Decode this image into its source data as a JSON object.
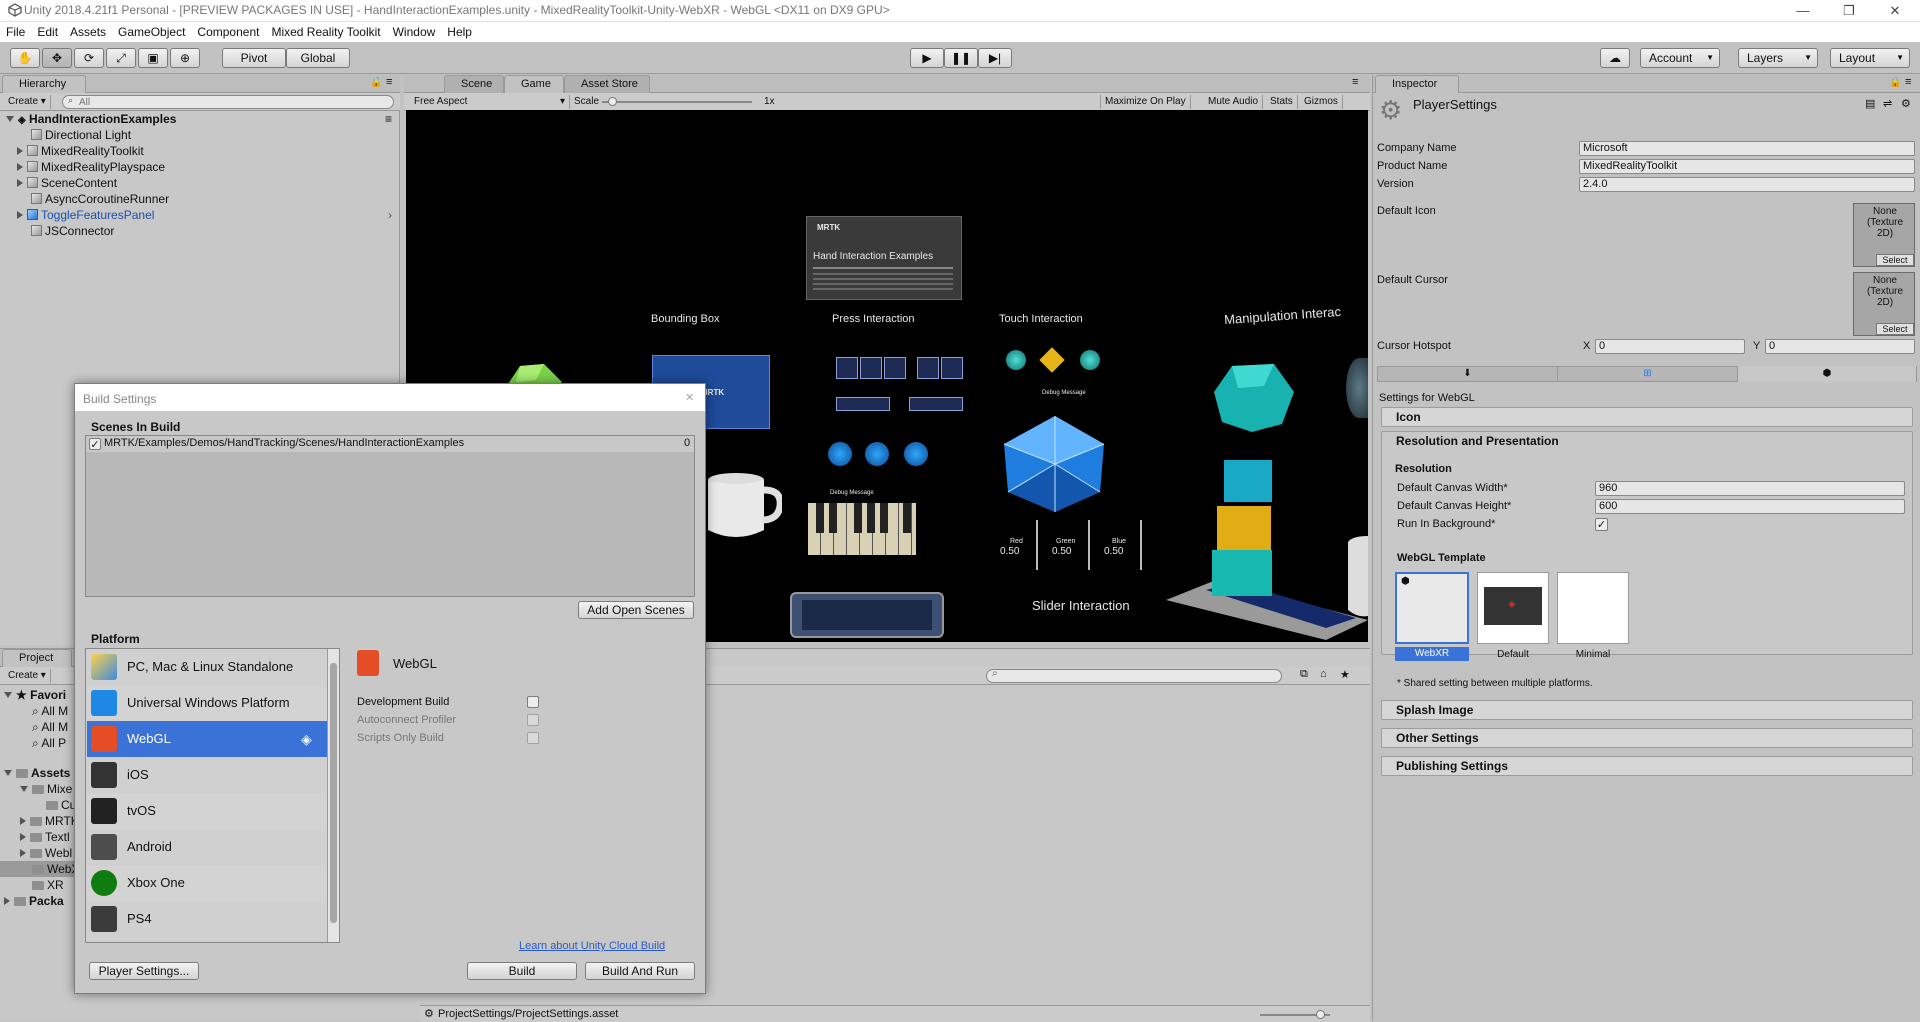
{
  "window": {
    "title": "Unity 2018.4.21f1 Personal - [PREVIEW PACKAGES IN USE] - HandInteractionExamples.unity - MixedRealityToolkit-Unity-WebXR - WebGL <DX11 on DX9 GPU>"
  },
  "menu": [
    "File",
    "Edit",
    "Assets",
    "GameObject",
    "Component",
    "Mixed Reality Toolkit",
    "Window",
    "Help"
  ],
  "toolbar": {
    "pivot": "Pivot",
    "global": "Global",
    "account": "Account",
    "layers": "Layers",
    "layout": "Layout"
  },
  "hierarchy": {
    "tab": "Hierarchy",
    "create": "Create",
    "search_placeholder": "All",
    "scene": "HandInteractionExamples",
    "items": [
      {
        "label": "Directional Light"
      },
      {
        "label": "MixedRealityToolkit"
      },
      {
        "label": "MixedRealityPlayspace"
      },
      {
        "label": "SceneContent"
      },
      {
        "label": "AsyncCoroutineRunner"
      },
      {
        "label": "ToggleFeaturesPanel"
      },
      {
        "label": "JSConnector"
      }
    ]
  },
  "sceneview": {
    "tabs": [
      "Scene",
      "Game",
      "Asset Store"
    ],
    "aspect": "Free Aspect",
    "scale_label": "Scale",
    "scale_value": "1x",
    "options": [
      "Maximize On Play",
      "Mute Audio",
      "Stats",
      "Gizmos"
    ],
    "content": {
      "card_logo": "MRTK",
      "card_title": "Hand Interaction Examples",
      "bounding": "Bounding Box",
      "press": "Press Interaction",
      "touch": "Touch Interaction",
      "manip": "Manipulation Interac",
      "slider": "Slider Interaction",
      "debug1": "Debug Message",
      "debug2": "Debug Message",
      "debug3": "Debug Message",
      "r_label": "Red",
      "g_label": "Green",
      "b_label": "Blue",
      "r_val": "0.50",
      "g_val": "0.50",
      "b_val": "0.50"
    }
  },
  "project": {
    "tab": "Project",
    "create": "Create",
    "favorites": "Favori",
    "fav_items": [
      "All M",
      "All M",
      "All P"
    ],
    "assets": "Assets",
    "asset_items": [
      "Mixe",
      "Cu",
      "MRTK",
      "Textl",
      "Webl",
      "WebX",
      "XR"
    ],
    "packages": "Packa",
    "path": "ProjectSettings/ProjectSettings.asset"
  },
  "inspector": {
    "tab": "Inspector",
    "title": "PlayerSettings",
    "company_label": "Company Name",
    "company": "Microsoft",
    "product_label": "Product Name",
    "product": "MixedRealityToolkit",
    "version_label": "Version",
    "version": "2.4.0",
    "icon_label": "Default Icon",
    "cursor_label": "Default Cursor",
    "none_text": "None (Texture 2D)",
    "select": "Select",
    "hotspot_label": "Cursor Hotspot",
    "x": "X",
    "x_val": "0",
    "y": "Y",
    "y_val": "0",
    "settings_for": "Settings for WebGL",
    "sections": {
      "icon": "Icon",
      "res_pres": "Resolution and Presentation",
      "splash": "Splash Image",
      "other": "Other Settings",
      "publishing": "Publishing Settings"
    },
    "resolution": "Resolution",
    "width_label": "Default Canvas Width*",
    "width": "960",
    "height_label": "Default Canvas Height*",
    "height": "600",
    "runbg_label": "Run In Background*",
    "template_label": "WebGL Template",
    "templates": [
      "WebXR",
      "Default",
      "Minimal"
    ],
    "shared_note": "* Shared setting between multiple platforms."
  },
  "build": {
    "title": "Build Settings",
    "scenes_header": "Scenes In Build",
    "scene_path": "MRTK/Examples/Demos/HandTracking/Scenes/HandInteractionExamples",
    "scene_index": "0",
    "add_open": "Add Open Scenes",
    "platform_header": "Platform",
    "platforms": [
      {
        "label": "PC, Mac & Linux Standalone"
      },
      {
        "label": "Universal Windows Platform"
      },
      {
        "label": "WebGL"
      },
      {
        "label": "iOS"
      },
      {
        "label": "tvOS"
      },
      {
        "label": "Android"
      },
      {
        "label": "Xbox One"
      },
      {
        "label": "PS4"
      }
    ],
    "selected_platform": "WebGL",
    "dev_build": "Development Build",
    "autoconnect": "Autoconnect Profiler",
    "scripts_only": "Scripts Only Build",
    "cloud_link": "Learn about Unity Cloud Build",
    "player_settings": "Player Settings...",
    "build": "Build",
    "build_and_run": "Build And Run"
  },
  "colors": {
    "selection": "#3a72d8",
    "editor_bg": "#c2c2c2",
    "accent_blue": "#3a72d8"
  }
}
